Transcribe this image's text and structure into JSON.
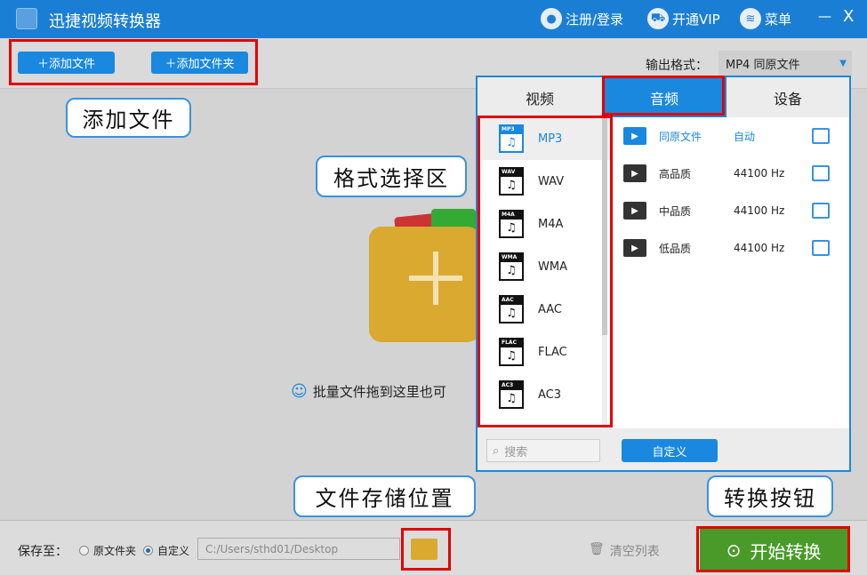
{
  "title": "迅捷视频转换器",
  "titlebar": {
    "register": "注册/登录",
    "vip": "开通VIP",
    "menu": "菜单",
    "minimize": "—",
    "close": "X"
  },
  "toolbar": {
    "add_file": "添加文件",
    "add_folder": "添加文件夹",
    "output_label": "输出格式：",
    "output_value": "MP4  同原文件"
  },
  "callouts": {
    "add_file": "添加文件",
    "format_area": "格式选择区",
    "save_location": "文件存储位置",
    "convert_button": "转换按钮"
  },
  "drop_hint": "批量文件拖到这里也可",
  "panel": {
    "tabs": [
      "视频",
      "音频",
      "设备"
    ],
    "active_tab": "音频",
    "formats": [
      "MP3",
      "WAV",
      "M4A",
      "WMA",
      "AAC",
      "FLAC",
      "AC3"
    ],
    "selected_format": "MP3",
    "qualities": [
      {
        "name": "同原文件",
        "rate": "自动"
      },
      {
        "name": "高品质",
        "rate": "44100 Hz"
      },
      {
        "name": "中品质",
        "rate": "44100 Hz"
      },
      {
        "name": "低品质",
        "rate": "44100 Hz"
      }
    ],
    "search_placeholder": "搜索",
    "custom": "自定义"
  },
  "bottom": {
    "save_to": "保存至：",
    "opt_original": "原文件夹",
    "opt_custom": "自定义",
    "path": "C:/Users/sthd01/Desktop",
    "clear": "清空列表",
    "start": "开始转换"
  },
  "colors": {
    "brand": "#1a7fd4",
    "accent": "#1a88de",
    "start": "#4a9a2a",
    "highlight": "#e30000"
  }
}
